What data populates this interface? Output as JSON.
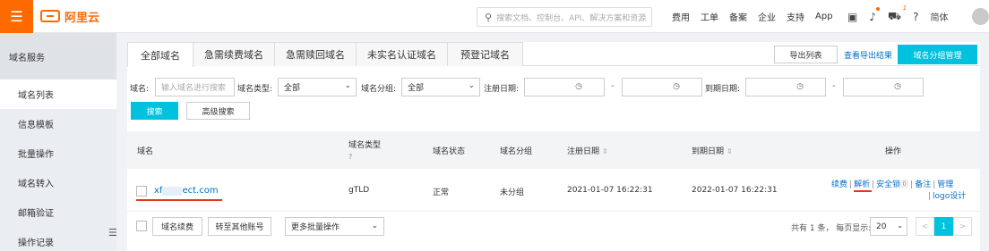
{
  "topbar": {
    "brand": "阿里云",
    "search_placeholder": "搜索文档、控制台、API、解决方案和资源",
    "links": [
      "费用",
      "工单",
      "备案",
      "企业",
      "支持",
      "App"
    ],
    "cart_badge": "1",
    "language": "简体"
  },
  "sidebar": {
    "header": "域名服务",
    "items": [
      "域名列表",
      "信息模板",
      "批量操作",
      "域名转入",
      "邮箱验证",
      "操作记录"
    ]
  },
  "tabs": [
    "全部域名",
    "急需续费域名",
    "急需赎回域名",
    "未实名认证域名",
    "预登记域名"
  ],
  "toolbar": {
    "export_label": "导出列表",
    "view_export_label": "查看导出结果",
    "group_manage_label": "域名分组管理"
  },
  "filters": {
    "domain_label": "域名:",
    "domain_placeholder": "输入域名进行搜索",
    "type_label": "域名类型:",
    "type_value": "全部",
    "group_label": "域名分组:",
    "group_value": "全部",
    "reg_date_label": "注册日期:",
    "expire_date_label": "到期日期:",
    "range_sep": "-",
    "search_label": "搜索",
    "advanced_label": "高级搜索"
  },
  "table": {
    "headers": {
      "domain": "域名",
      "type": "域名类型",
      "type_help": "?",
      "status": "域名状态",
      "group": "域名分组",
      "reg_date": "注册日期",
      "expire_date": "到期日期",
      "ops": "操作"
    },
    "rows": [
      {
        "domain_prefix": "xf",
        "domain_suffix": "ect.com",
        "type": "gTLD",
        "status": "正常",
        "group": "未分组",
        "reg_date": "2021-01-07 16:22:31",
        "expire_date": "2022-01-07 16:22:31"
      }
    ],
    "ops": {
      "renew": "续费",
      "resolve": "解析",
      "security_lock": "安全锁",
      "note": "备注",
      "manage": "管理",
      "logo_design": "logo设计",
      "sep": "|"
    }
  },
  "footer": {
    "renew_label": "域名续费",
    "transfer_label": "转至其他账号",
    "more_ops_label": "更多批量操作",
    "pager_text": "共有 1 条， 每页显示:",
    "page_size": "20",
    "current_page": "1",
    "prev": "<",
    "next": ">"
  },
  "colors": {
    "brand_orange": "#ff6a00",
    "primary_cyan": "#00c1de",
    "link_blue": "#0070cc",
    "highlight_red": "#e8341c"
  }
}
